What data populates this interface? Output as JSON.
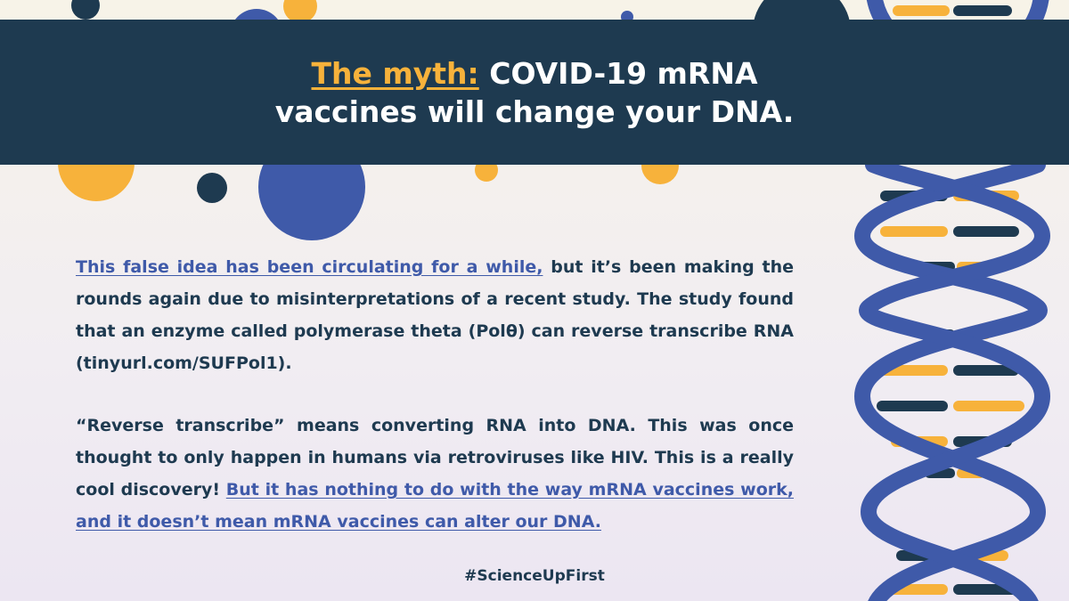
{
  "title": {
    "myth_label": "The myth:",
    "line1_rest": "COVID-19 mRNA",
    "line2": "vaccines will change your DNA."
  },
  "paragraph1": {
    "link": "This false idea has been circulating for a while,",
    "text": "but it’s been making the rounds again due to misinterpretations of a recent study. The study found that an enzyme called polymerase theta (Polθ) can reverse transcribe RNA (tinyurl.com/SUFPol1)."
  },
  "paragraph2": {
    "text": "“Reverse transcribe” means converting RNA into DNA. This was once thought to only happen in humans via retroviruses like HIV. This is a really cool discovery!",
    "link": "But it has nothing to do with the way mRNA vaccines work, and it doesn’t mean mRNA vaccines can alter our DNA."
  },
  "hashtag": "#ScienceUpFirst",
  "colors": {
    "navy": "#1e3a50",
    "gold": "#f7b23b",
    "blue": "#3f5aa9",
    "background": "#f7f3e8"
  },
  "decoration": {
    "dna_helix": "dna-helix-icon",
    "dots": "decorative-circles"
  }
}
